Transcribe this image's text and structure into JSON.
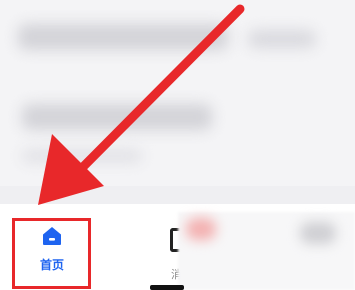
{
  "tabbar": {
    "home": {
      "label": "首页",
      "icon": "home-icon",
      "color": "#1e64f0",
      "selected": true
    },
    "second": {
      "label": "消",
      "icon": "message-icon"
    }
  },
  "annotation": {
    "arrow_color": "#e8282a",
    "highlight_color": "#e8282a"
  }
}
